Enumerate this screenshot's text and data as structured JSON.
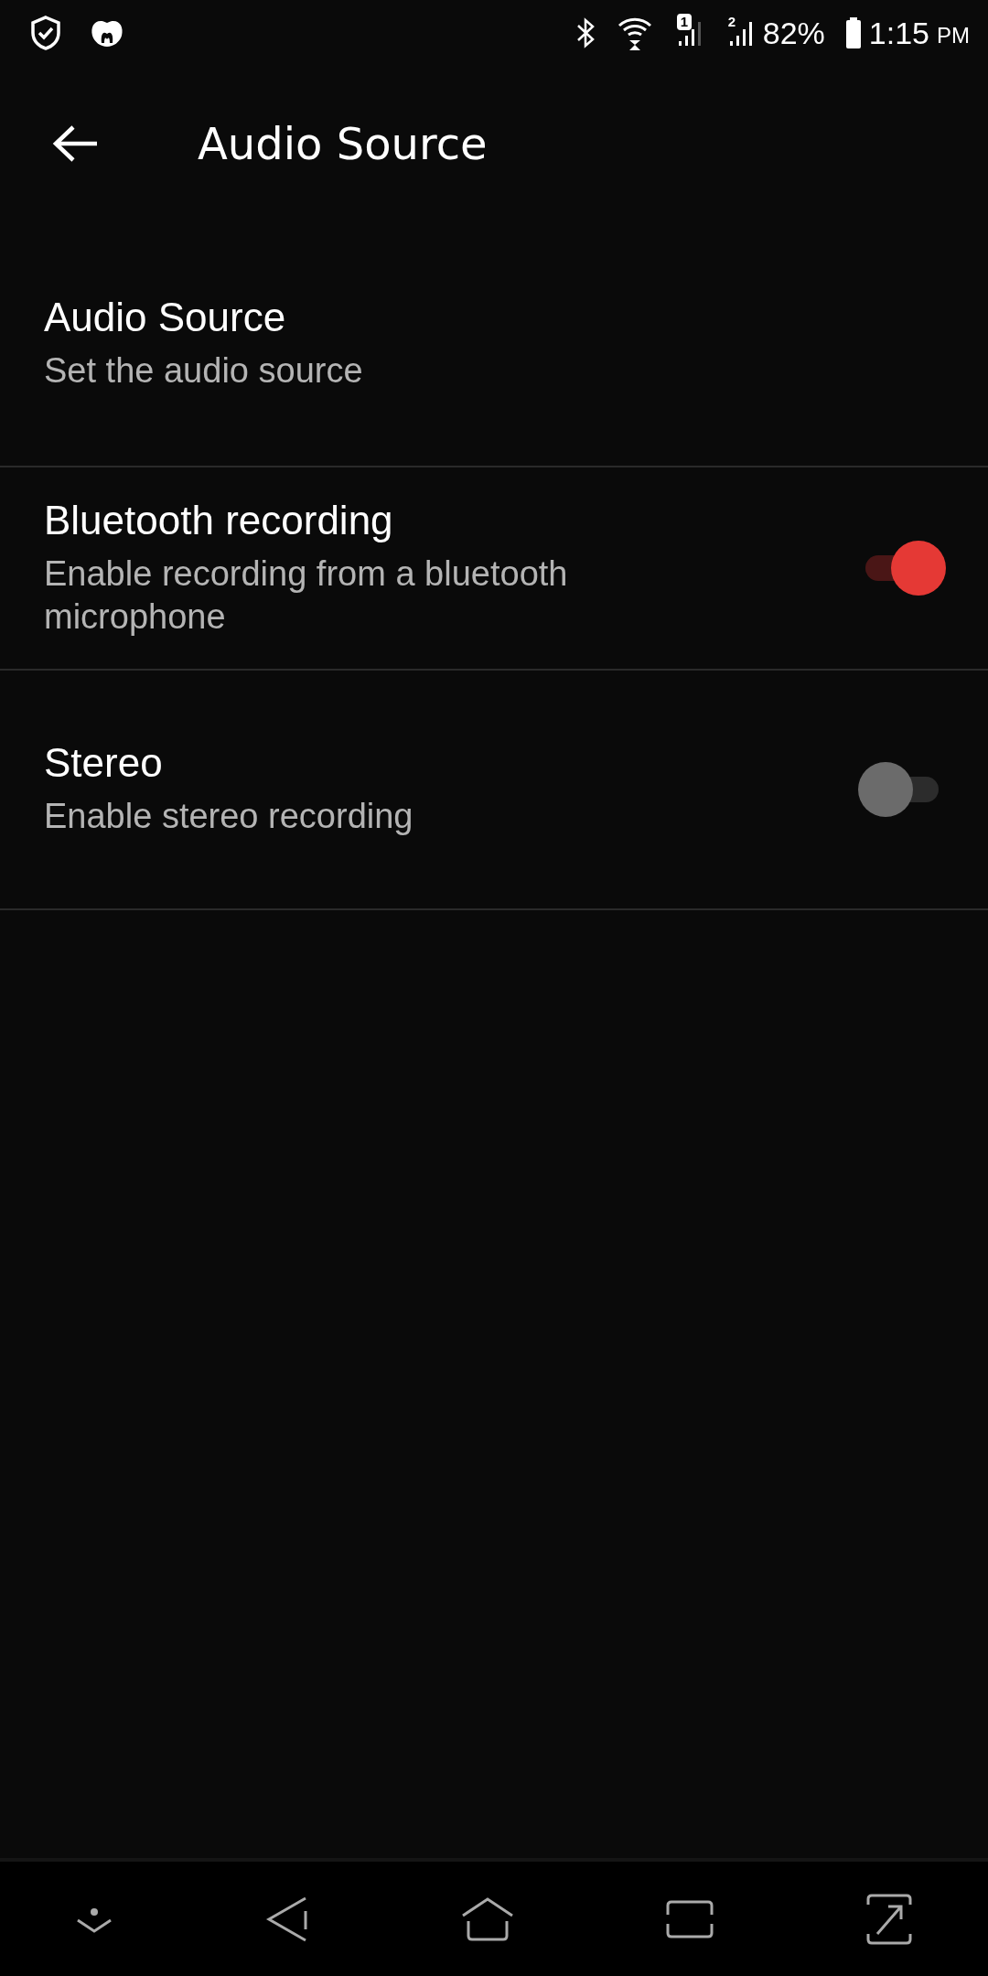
{
  "status_bar": {
    "sim1": "1",
    "sim2": "2",
    "battery": "82%",
    "time": "1:15",
    "ampm": "PM"
  },
  "toolbar": {
    "title": "Audio Source"
  },
  "items": [
    {
      "kind": "plain",
      "title": "Audio Source",
      "summary": "Set the audio source"
    },
    {
      "kind": "switch",
      "title": "Bluetooth recording",
      "summary": "Enable recording from a bluetooth microphone",
      "on": true
    },
    {
      "kind": "switch",
      "title": "Stereo",
      "summary": "Enable stereo recording",
      "on": false
    }
  ]
}
